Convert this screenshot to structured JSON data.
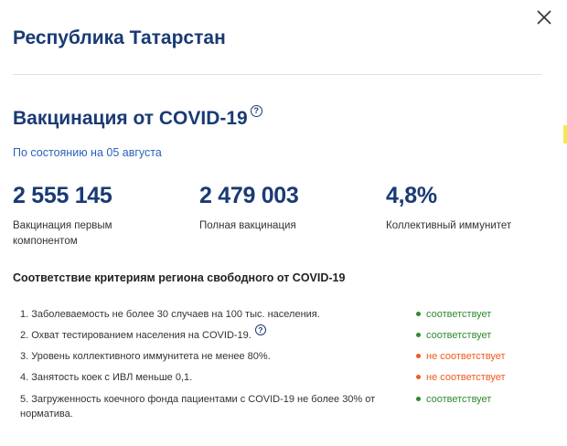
{
  "header": {
    "region_title": "Республика Татарстан",
    "close_icon": "close-icon"
  },
  "vaccination": {
    "title": "Вакцинация от COVID-19",
    "help_glyph": "?",
    "as_of": "По состоянию на 05 августа"
  },
  "stats": [
    {
      "value": "2 555 145",
      "label": "Вакцинация первым компонентом"
    },
    {
      "value": "2 479 003",
      "label": "Полная вакцинация"
    },
    {
      "value": "4,8%",
      "label": "Коллективный иммунитет"
    }
  ],
  "criteria": {
    "title": "Соответствие критериям региона свободного от COVID-19",
    "items": [
      {
        "text": "1. Заболеваемость не более 30 случаев на 100 тыс. населения.",
        "status": "соответствует",
        "ok": true
      },
      {
        "text": "2. Охват тестированием населения на COVID-19.",
        "status": "соответствует",
        "ok": true,
        "help": "?"
      },
      {
        "text": "3. Уровень коллективного иммунитета не менее 80%.",
        "status": "не соответствует",
        "ok": false
      },
      {
        "text": "4. Занятость коек с ИВЛ меньше 0,1.",
        "status": "не соответствует",
        "ok": false
      },
      {
        "text": "5. Загруженность коечного фонда пациентами с COVID-19 не более 30% от норматива.",
        "status": "соответствует",
        "ok": true
      }
    ]
  },
  "colors": {
    "title": "#1a3a74",
    "link": "#2a63b8",
    "ok": "#2e8b2e",
    "bad": "#ef5a1f"
  }
}
